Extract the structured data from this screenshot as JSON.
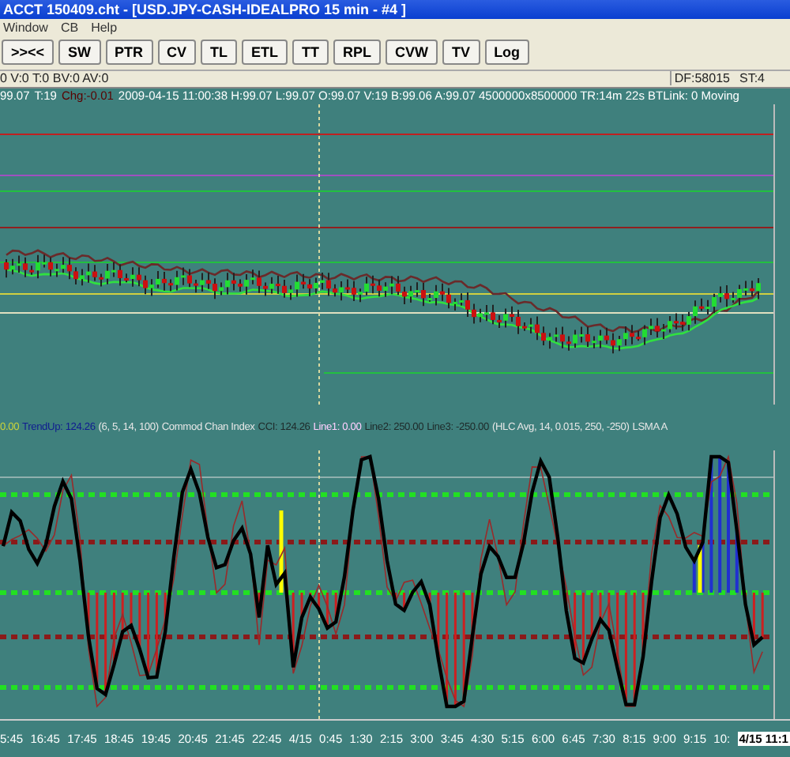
{
  "window": {
    "title": "ACCT 150409.cht - [USD.JPY-CASH-IDEALPRO  15 min  - #4 ]"
  },
  "menu": [
    "Window",
    "CB",
    "Help"
  ],
  "toolbar": {
    "buttons": [
      ">><<",
      "SW",
      "PTR",
      "CV",
      "TL",
      "ETL",
      "TT",
      "RPL",
      "CVW",
      "TV",
      "Log"
    ]
  },
  "info_bar": {
    "left": "0 V:0 T:0 BV:0 AV:0",
    "right": [
      "DF:58015",
      "ST:4"
    ]
  },
  "status_line": [
    {
      "text": "99.07",
      "color": "#ffffff"
    },
    {
      "text": "T:19",
      "color": "#ffffff"
    },
    {
      "text": "Chg:-0.01",
      "color": "#5a0000"
    },
    {
      "text": "2009-04-15 11:00:38 H:99.07 L:99.07 O:99.07 V:19 B:99.06 A:99.07 4500000x8500000 TR:14m 22s BTLink: 0 Moving",
      "color": "#ffffff"
    }
  ],
  "indicator_legend": [
    {
      "text": "0.00",
      "color": "#c8d23c"
    },
    {
      "text": "TrendUp: 124.26",
      "color": "#101c90"
    },
    {
      "text": "(6, 5, 14, 100)",
      "color": "#e6e6e6"
    },
    {
      "text": "Commod Chan Index",
      "color": "#e6e6e6"
    },
    {
      "text": "CCI: 124.26",
      "color": "#1e2a2a"
    },
    {
      "text": "Line1: 0.00",
      "color": "#ffd0ff"
    },
    {
      "text": "Line2: 250.00",
      "color": "#1e2a2a"
    },
    {
      "text": "Line3: -250.00",
      "color": "#1e2a2a"
    },
    {
      "text": "(HLC Avg, 14, 0.015, 250, -250)",
      "color": "#e6e6e6"
    },
    {
      "text": "LSMA A",
      "color": "#e6e6e6"
    }
  ],
  "x_axis": {
    "labels": [
      "5:45",
      "16:45",
      "17:45",
      "18:45",
      "19:45",
      "20:45",
      "21:45",
      "22:45",
      "4/15",
      "0:45",
      "1:30",
      "2:15",
      "3:00",
      "3:45",
      "4:30",
      "5:15",
      "6:00",
      "6:45",
      "7:30",
      "8:15",
      "9:00",
      "9:15",
      "10:"
    ],
    "current": "4/15 11:1"
  }
}
